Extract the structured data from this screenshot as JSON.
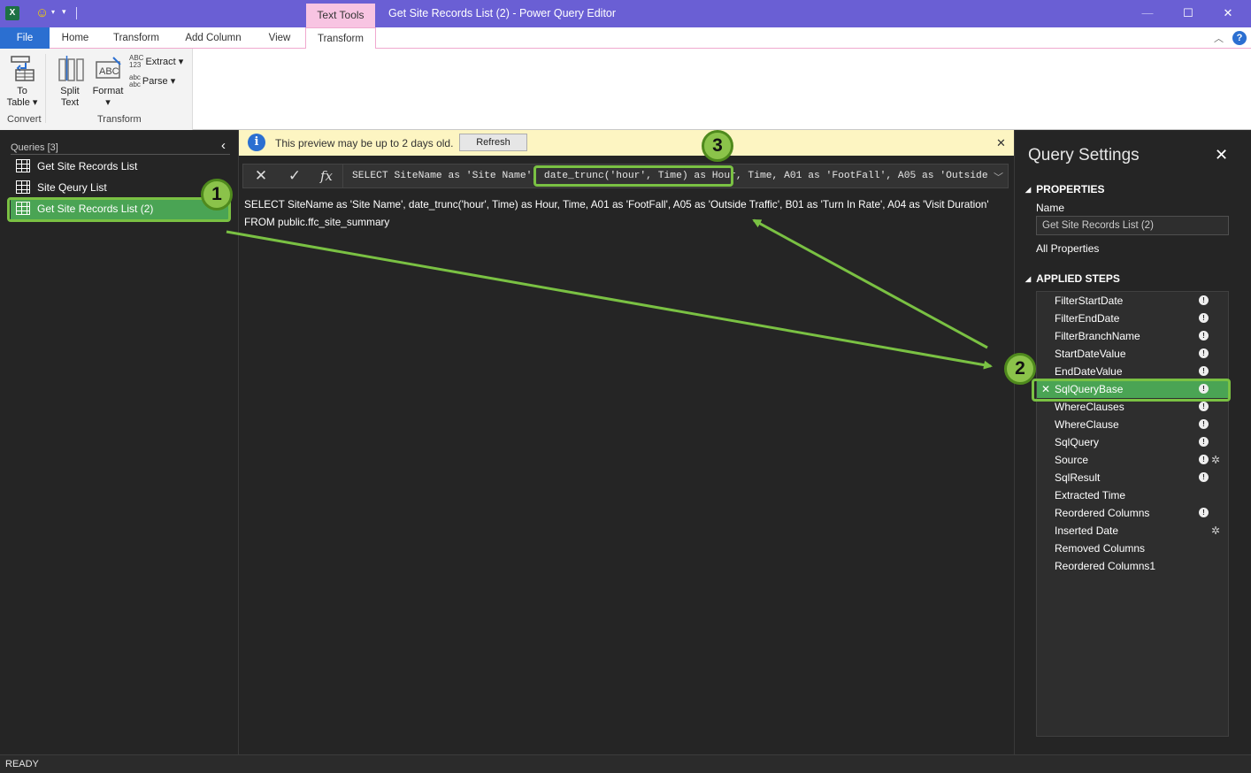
{
  "titlebar": {
    "app_icon": "excel-icon",
    "context_tab": "Text Tools",
    "window_title": "Get Site Records List (2) - Power Query Editor",
    "minimize": "—",
    "maximize": "☐",
    "close": "✕"
  },
  "tabs": {
    "file": "File",
    "home": "Home",
    "transform": "Transform",
    "add_column": "Add Column",
    "view": "View",
    "text_transform": "Transform",
    "help": "?"
  },
  "ribbon": {
    "to_table_line1": "To",
    "to_table_line2": "Table ▾",
    "split_line1": "Split",
    "split_line2": "Text",
    "format_label": "Format",
    "format_caret": "▾",
    "extract_icon_top": "ABC",
    "extract_icon_bottom": "123",
    "extract": "Extract ▾",
    "parse_icon_top": "abc",
    "parse_icon_bottom": "abc",
    "parse": "Parse ▾",
    "group_convert": "Convert",
    "group_transform": "Transform"
  },
  "queries": {
    "header": "Queries [3]",
    "items": [
      "Get Site Records List",
      "Site Qeury List",
      "Get Site Records List (2)"
    ],
    "selected_index": 2
  },
  "notice": {
    "text": "This preview may be up to 2 days old.",
    "refresh": "Refresh",
    "close": "✕"
  },
  "formula": {
    "cancel": "✕",
    "commit": "✓",
    "fx": "fx",
    "text": "SELECT SiteName as 'Site Name', date_trunc('hour', Time) as Hour, Time, A01 as 'FootFall', A05 as 'Outside"
  },
  "preview": {
    "line1": "SELECT SiteName as 'Site Name', date_trunc('hour', Time) as Hour, Time, A01 as 'FootFall', A05 as 'Outside Traffic', B01 as 'Turn In Rate', A04 as 'Visit Duration'",
    "line2": "FROM public.ffc_site_summary"
  },
  "settings": {
    "title": "Query Settings",
    "properties": "PROPERTIES",
    "name_label": "Name",
    "name_value": "Get Site Records List (2)",
    "all_properties": "All Properties",
    "applied_steps": "APPLIED STEPS",
    "steps": [
      {
        "label": "FilterStartDate",
        "info": true,
        "gear": false
      },
      {
        "label": "FilterEndDate",
        "info": true,
        "gear": false
      },
      {
        "label": "FilterBranchName",
        "info": true,
        "gear": false
      },
      {
        "label": "StartDateValue",
        "info": true,
        "gear": false
      },
      {
        "label": "EndDateValue",
        "info": true,
        "gear": false
      },
      {
        "label": "SqlQueryBase",
        "info": true,
        "gear": false,
        "selected": true
      },
      {
        "label": "WhereClauses",
        "info": true,
        "gear": false
      },
      {
        "label": "WhereClause",
        "info": true,
        "gear": false
      },
      {
        "label": "SqlQuery",
        "info": true,
        "gear": false
      },
      {
        "label": "Source",
        "info": true,
        "gear": true
      },
      {
        "label": "SqlResult",
        "info": true,
        "gear": false
      },
      {
        "label": "Extracted Time",
        "info": false,
        "gear": false
      },
      {
        "label": "Reordered Columns",
        "info": true,
        "gear": false
      },
      {
        "label": "Inserted Date",
        "info": false,
        "gear": true
      },
      {
        "label": "Removed Columns",
        "info": false,
        "gear": false
      },
      {
        "label": "Reordered Columns1",
        "info": false,
        "gear": false
      }
    ]
  },
  "status": "READY",
  "annotations": [
    "1",
    "2",
    "3"
  ],
  "colors": {
    "titlebar": "#6a5fd4",
    "file_tab": "#2b6fd1",
    "context_tab": "#f8c4e2",
    "selection": "#4aa454",
    "annotation": "#7ac143"
  }
}
